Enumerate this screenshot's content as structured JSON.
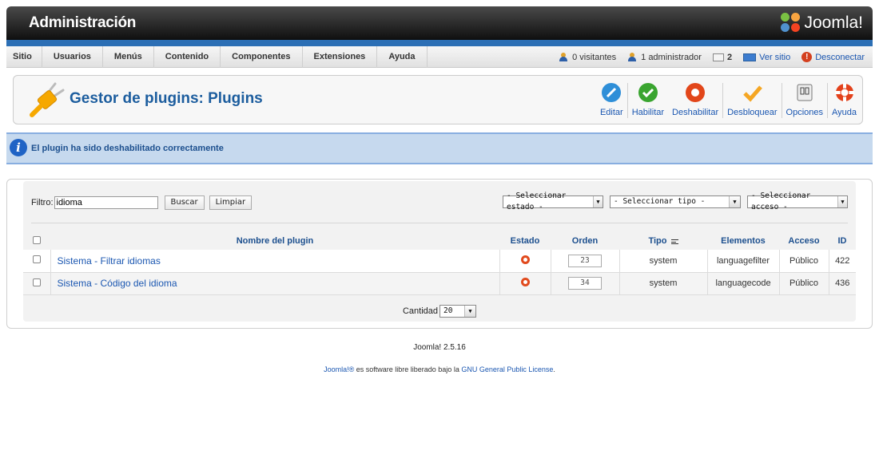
{
  "header": {
    "title": "Administración",
    "logo_text": "Joomla!"
  },
  "menu": [
    "Sitio",
    "Usuarios",
    "Menús",
    "Contenido",
    "Componentes",
    "Extensiones",
    "Ayuda"
  ],
  "status": {
    "visitors": "0 visitantes",
    "admins": "1 administrador",
    "messages": "2",
    "view_site": "Ver sitio",
    "logout": "Desconectar"
  },
  "toolbar": {
    "title": "Gestor de plugins: Plugins",
    "buttons": {
      "edit": "Editar",
      "enable": "Habilitar",
      "disable": "Deshabilitar",
      "checkin": "Desbloquear",
      "options": "Opciones",
      "help": "Ayuda"
    }
  },
  "message": "El plugin ha sido deshabilitado correctamente",
  "filter": {
    "label": "Filtro:",
    "value": "idioma",
    "search_button": "Buscar",
    "clear_button": "Limpiar",
    "status_select": "- Seleccionar estado -",
    "type_select": "- Seleccionar tipo -",
    "access_select": "- Seleccionar acceso -"
  },
  "table": {
    "headers": {
      "name": "Nombre del plugin",
      "status": "Estado",
      "order": "Orden",
      "type": "Tipo",
      "element": "Elementos",
      "access": "Acceso",
      "id": "ID"
    },
    "rows": [
      {
        "name": "Sistema - Filtrar idiomas",
        "order": "23",
        "type": "system",
        "element": "languagefilter",
        "access": "Público",
        "id": "422"
      },
      {
        "name": "Sistema - Código del idioma",
        "order": "34",
        "type": "system",
        "element": "languagecode",
        "access": "Público",
        "id": "436"
      }
    ]
  },
  "pagination": {
    "label": "Cantidad",
    "value": "20"
  },
  "footer": {
    "version": "Joomla! 2.5.16",
    "license_prefix": "Joomla!®",
    "license_middle": " es software libre liberado bajo la ",
    "license_link": "GNU General Public License",
    "license_suffix": "."
  },
  "colors": {
    "brand_blue": "#2c6fb5",
    "link": "#1b57b1",
    "title": "#1c5d9e",
    "disabled_status": "#e14a1d"
  }
}
